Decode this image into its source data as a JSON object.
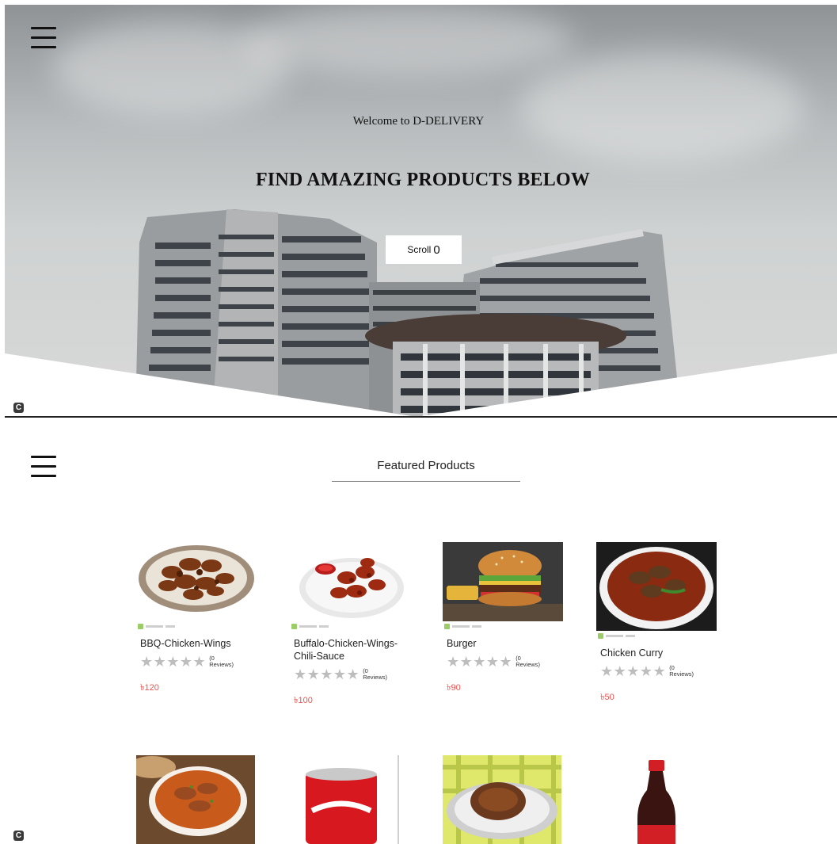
{
  "hero": {
    "welcome": "Welcome to D-DELIVERY",
    "title": "FIND AMAZING PRODUCTS BELOW",
    "scroll_label": "Scroll",
    "scroll_glyph": "0",
    "badge": "C"
  },
  "featured": {
    "title": "Featured Products",
    "badge": "C",
    "products": [
      {
        "name": "BBQ-Chicken-Wings",
        "reviews": "(0 Reviews)",
        "price": "৳120",
        "rating": 0
      },
      {
        "name": "Buffalo-Chicken-Wings-Chili-Sauce",
        "reviews": "(0 Reviews)",
        "price": "৳100",
        "rating": 0
      },
      {
        "name": "Burger",
        "reviews": "(0 Reviews)",
        "price": "৳90",
        "rating": 0
      },
      {
        "name": "Chicken Curry",
        "reviews": "(0 Reviews)",
        "price": "৳50",
        "rating": 0
      }
    ],
    "stars": "★★★★★"
  },
  "icons": {
    "menu": "hamburger-menu-icon",
    "badge": "c-logo-icon"
  },
  "colors": {
    "price": "#ef5350",
    "star_empty": "#bdbdbd"
  }
}
